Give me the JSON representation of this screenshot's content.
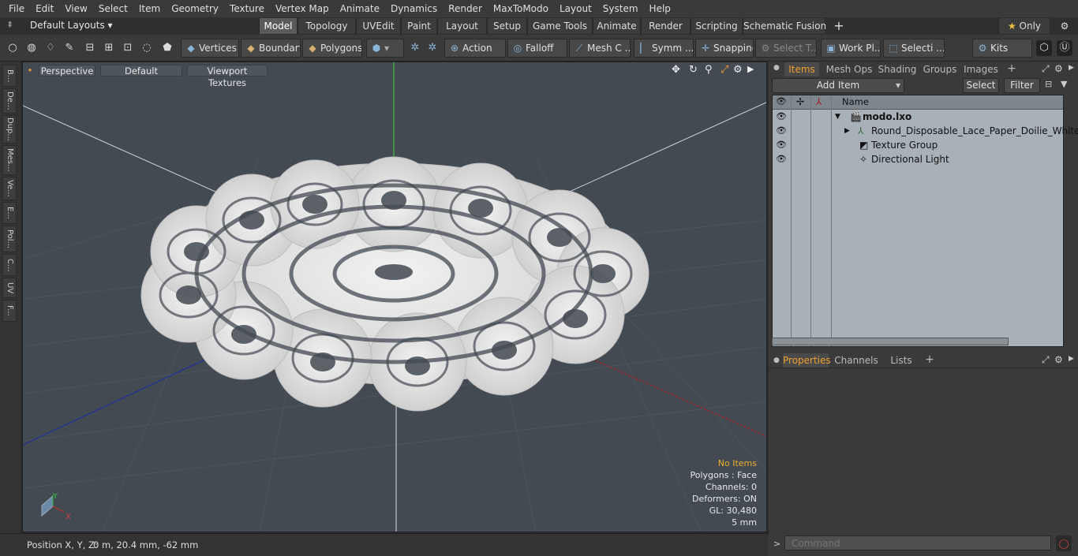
{
  "menu": [
    "File",
    "Edit",
    "View",
    "Select",
    "Item",
    "Geometry",
    "Texture",
    "Vertex Map",
    "Animate",
    "Dynamics",
    "Render",
    "MaxToModo",
    "Layout",
    "System",
    "Help"
  ],
  "layout_bar": {
    "layouts_label": "Default Layouts",
    "tabs": [
      "Model",
      "Topology",
      "UVEdit",
      "Paint",
      "Layout",
      "Setup",
      "Game Tools",
      "Animate",
      "Render",
      "Scripting",
      "Schematic Fusion"
    ],
    "active_tab": "Model",
    "add": "+",
    "only_label": "Only"
  },
  "toolbar": {
    "vertices": "Vertices",
    "boundary": "Boundary",
    "polygons": "Polygons",
    "action": "Action",
    "falloff": "Falloff",
    "mesh_c": "Mesh C ...",
    "symm": "Symm ...",
    "snapping": "Snapping",
    "select_t": "Select T...",
    "work_pl": "Work Pl...",
    "selecti": "Selecti ...",
    "kits": "Kits"
  },
  "left_strip": [
    "B...",
    "De...",
    "Dup...",
    "Mes...",
    "Ve...",
    "E...",
    "Pol...",
    "C...",
    "UV",
    "F..."
  ],
  "viewport": {
    "perspective": "Perspective",
    "default": "Default",
    "viewport_textures": "Viewport Textures",
    "stats": {
      "no_items": "No Items",
      "polygons": "Polygons : Face",
      "channels": "Channels: 0",
      "deformers": "Deformers: ON",
      "gl": "GL: 30,480",
      "scale": "5 mm"
    },
    "axis_y": "Y",
    "axis_x": "X"
  },
  "status": {
    "position_label": "Position X, Y, Z:",
    "position_value": "0 m, 20.4 mm, -62 mm"
  },
  "items_panel": {
    "tabs": [
      "Items",
      "Mesh Ops",
      "Shading",
      "Groups",
      "Images"
    ],
    "active": "Items",
    "add_item": "Add Item",
    "select": "Select",
    "filter": "Filter",
    "name_header": "Name",
    "rows": [
      {
        "name": "modo.lxo",
        "icon": "scene-icon"
      },
      {
        "name": "Round_Disposable_Lace_Paper_Doilie_White",
        "icon": "mesh-icon"
      },
      {
        "name": "Texture Group",
        "icon": "texture-group-icon"
      },
      {
        "name": "Directional Light",
        "icon": "light-icon"
      }
    ]
  },
  "properties_panel": {
    "tabs": [
      "Properties",
      "Channels",
      "Lists"
    ],
    "active": "Properties"
  },
  "command": {
    "placeholder": "Command"
  },
  "colors": {
    "accent_orange": "#f0a030",
    "viewport_bg": "#434a52",
    "doily": "#e6e6e6"
  }
}
